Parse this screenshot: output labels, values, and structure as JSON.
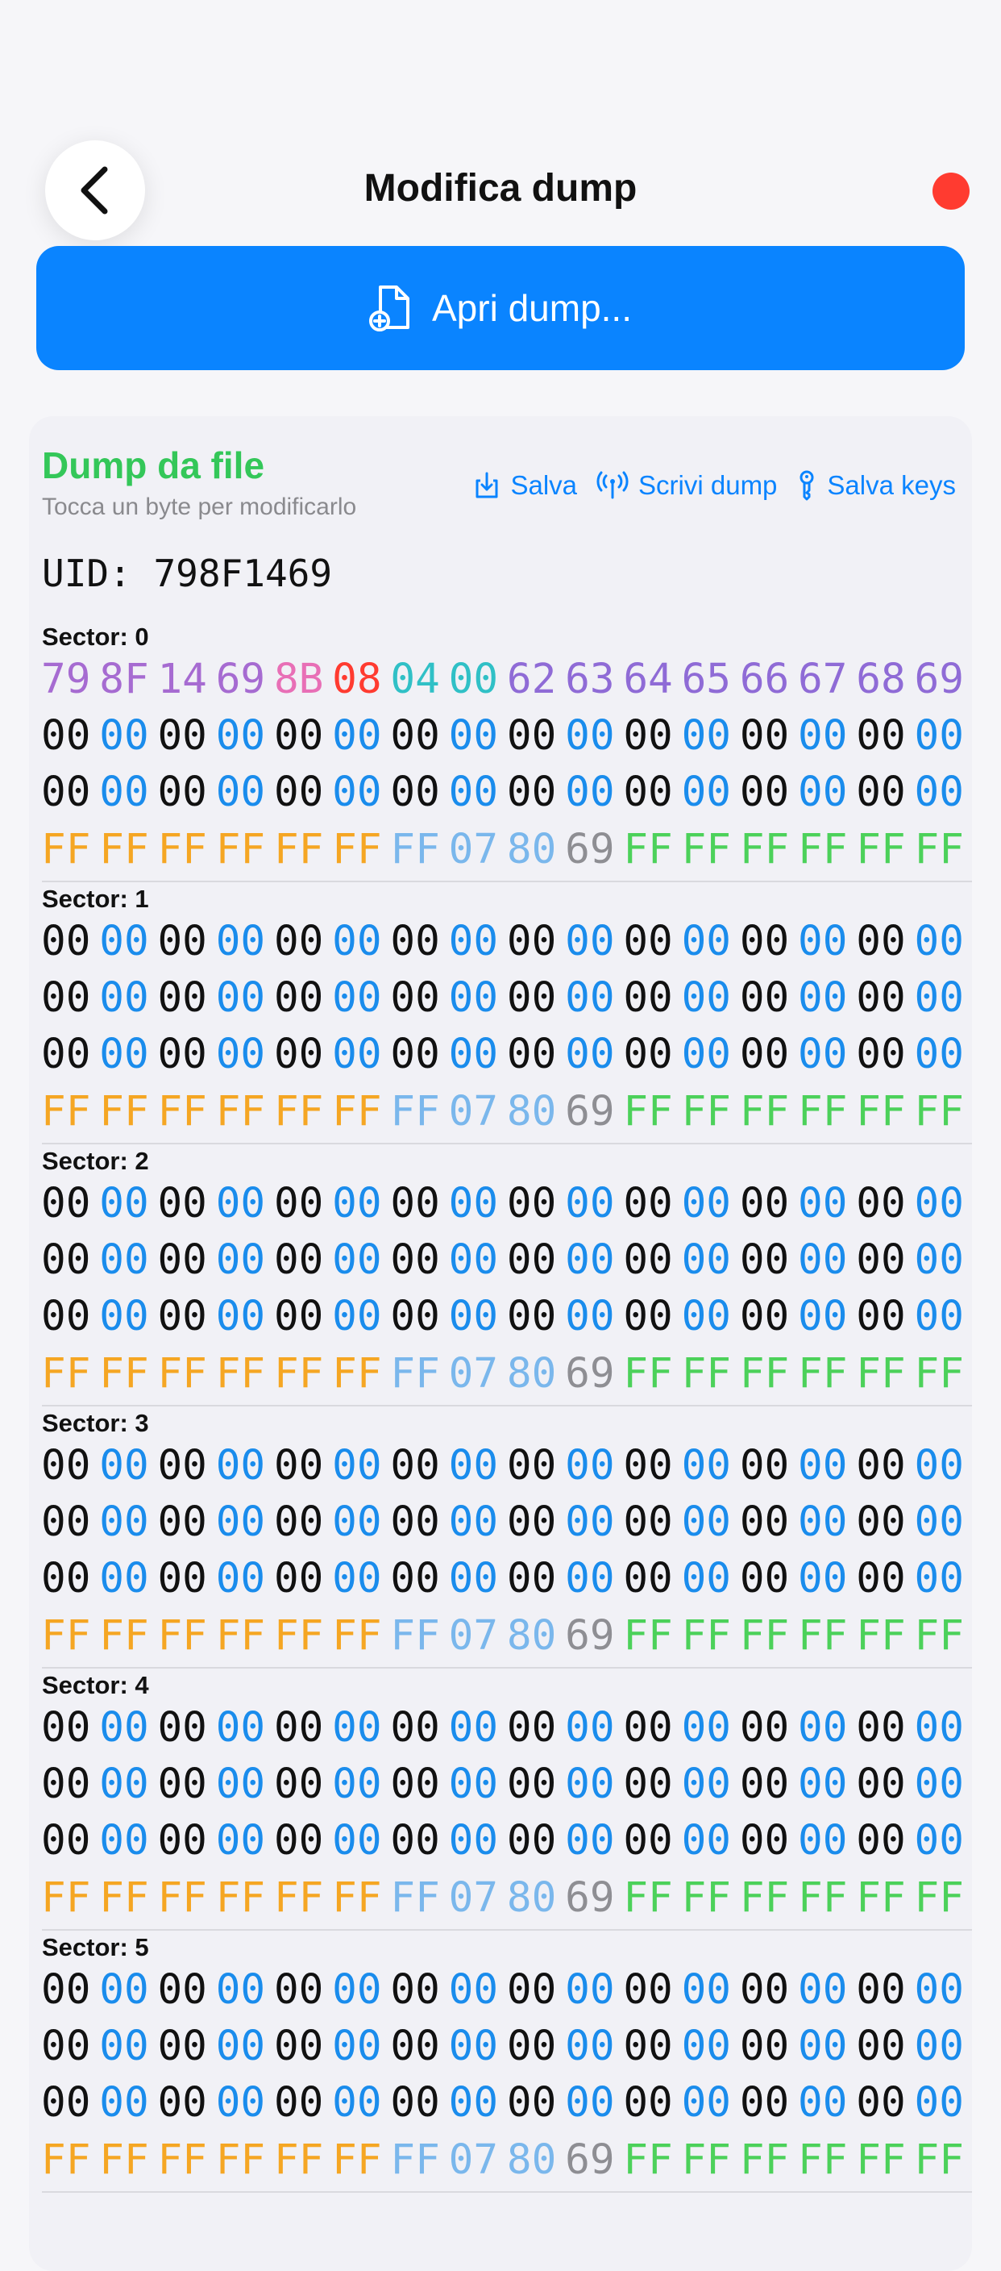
{
  "header": {
    "title": "Modifica dump"
  },
  "open_button": {
    "label": "Apri dump..."
  },
  "card": {
    "title": "Dump da file",
    "subtitle": "Tocca un byte per modificarlo",
    "actions": [
      {
        "label": "Salva",
        "icon": "download-icon"
      },
      {
        "label": "Scrivi dump",
        "icon": "antenna-icon"
      },
      {
        "label": "Salva keys",
        "icon": "key-icon"
      }
    ],
    "uid": "UID: 798F1469"
  },
  "colors": {
    "accent": "#0a84ff",
    "record_dot": "#ff3b30",
    "title_green": "#34c759",
    "byte_black": "#111111",
    "byte_blue": "#1a8cec",
    "uid_purple": "#a66bd1",
    "bcc_pink": "#e86fb6",
    "sak_red": "#ff3b30",
    "atqa_teal": "#30c0c6",
    "manufacturer_purple": "#8f6bd6",
    "key_a_orange": "#f5a623",
    "access_bits_light_blue": "#7ab7ec",
    "user_byte_gray": "#8e8e93",
    "key_b_green": "#4cd15a"
  },
  "sectors": [
    {
      "label": "Sector: 0",
      "rows": [
        [
          "79",
          "8F",
          "14",
          "69",
          "8B",
          "08",
          "04",
          "00",
          "62",
          "63",
          "64",
          "65",
          "66",
          "67",
          "68",
          "69"
        ],
        [
          "00",
          "00",
          "00",
          "00",
          "00",
          "00",
          "00",
          "00",
          "00",
          "00",
          "00",
          "00",
          "00",
          "00",
          "00",
          "00"
        ],
        [
          "00",
          "00",
          "00",
          "00",
          "00",
          "00",
          "00",
          "00",
          "00",
          "00",
          "00",
          "00",
          "00",
          "00",
          "00",
          "00"
        ],
        [
          "FF",
          "FF",
          "FF",
          "FF",
          "FF",
          "FF",
          "FF",
          "07",
          "80",
          "69",
          "FF",
          "FF",
          "FF",
          "FF",
          "FF",
          "FF"
        ]
      ]
    },
    {
      "label": "Sector: 1",
      "rows": [
        [
          "00",
          "00",
          "00",
          "00",
          "00",
          "00",
          "00",
          "00",
          "00",
          "00",
          "00",
          "00",
          "00",
          "00",
          "00",
          "00"
        ],
        [
          "00",
          "00",
          "00",
          "00",
          "00",
          "00",
          "00",
          "00",
          "00",
          "00",
          "00",
          "00",
          "00",
          "00",
          "00",
          "00"
        ],
        [
          "00",
          "00",
          "00",
          "00",
          "00",
          "00",
          "00",
          "00",
          "00",
          "00",
          "00",
          "00",
          "00",
          "00",
          "00",
          "00"
        ],
        [
          "FF",
          "FF",
          "FF",
          "FF",
          "FF",
          "FF",
          "FF",
          "07",
          "80",
          "69",
          "FF",
          "FF",
          "FF",
          "FF",
          "FF",
          "FF"
        ]
      ]
    },
    {
      "label": "Sector: 2",
      "rows": [
        [
          "00",
          "00",
          "00",
          "00",
          "00",
          "00",
          "00",
          "00",
          "00",
          "00",
          "00",
          "00",
          "00",
          "00",
          "00",
          "00"
        ],
        [
          "00",
          "00",
          "00",
          "00",
          "00",
          "00",
          "00",
          "00",
          "00",
          "00",
          "00",
          "00",
          "00",
          "00",
          "00",
          "00"
        ],
        [
          "00",
          "00",
          "00",
          "00",
          "00",
          "00",
          "00",
          "00",
          "00",
          "00",
          "00",
          "00",
          "00",
          "00",
          "00",
          "00"
        ],
        [
          "FF",
          "FF",
          "FF",
          "FF",
          "FF",
          "FF",
          "FF",
          "07",
          "80",
          "69",
          "FF",
          "FF",
          "FF",
          "FF",
          "FF",
          "FF"
        ]
      ]
    },
    {
      "label": "Sector: 3",
      "rows": [
        [
          "00",
          "00",
          "00",
          "00",
          "00",
          "00",
          "00",
          "00",
          "00",
          "00",
          "00",
          "00",
          "00",
          "00",
          "00",
          "00"
        ],
        [
          "00",
          "00",
          "00",
          "00",
          "00",
          "00",
          "00",
          "00",
          "00",
          "00",
          "00",
          "00",
          "00",
          "00",
          "00",
          "00"
        ],
        [
          "00",
          "00",
          "00",
          "00",
          "00",
          "00",
          "00",
          "00",
          "00",
          "00",
          "00",
          "00",
          "00",
          "00",
          "00",
          "00"
        ],
        [
          "FF",
          "FF",
          "FF",
          "FF",
          "FF",
          "FF",
          "FF",
          "07",
          "80",
          "69",
          "FF",
          "FF",
          "FF",
          "FF",
          "FF",
          "FF"
        ]
      ]
    },
    {
      "label": "Sector: 4",
      "rows": [
        [
          "00",
          "00",
          "00",
          "00",
          "00",
          "00",
          "00",
          "00",
          "00",
          "00",
          "00",
          "00",
          "00",
          "00",
          "00",
          "00"
        ],
        [
          "00",
          "00",
          "00",
          "00",
          "00",
          "00",
          "00",
          "00",
          "00",
          "00",
          "00",
          "00",
          "00",
          "00",
          "00",
          "00"
        ],
        [
          "00",
          "00",
          "00",
          "00",
          "00",
          "00",
          "00",
          "00",
          "00",
          "00",
          "00",
          "00",
          "00",
          "00",
          "00",
          "00"
        ],
        [
          "FF",
          "FF",
          "FF",
          "FF",
          "FF",
          "FF",
          "FF",
          "07",
          "80",
          "69",
          "FF",
          "FF",
          "FF",
          "FF",
          "FF",
          "FF"
        ]
      ]
    },
    {
      "label": "Sector: 5",
      "rows": [
        [
          "00",
          "00",
          "00",
          "00",
          "00",
          "00",
          "00",
          "00",
          "00",
          "00",
          "00",
          "00",
          "00",
          "00",
          "00",
          "00"
        ],
        [
          "00",
          "00",
          "00",
          "00",
          "00",
          "00",
          "00",
          "00",
          "00",
          "00",
          "00",
          "00",
          "00",
          "00",
          "00",
          "00"
        ],
        [
          "00",
          "00",
          "00",
          "00",
          "00",
          "00",
          "00",
          "00",
          "00",
          "00",
          "00",
          "00",
          "00",
          "00",
          "00",
          "00"
        ],
        [
          "FF",
          "FF",
          "FF",
          "FF",
          "FF",
          "FF",
          "FF",
          "07",
          "80",
          "69",
          "FF",
          "FF",
          "FF",
          "FF",
          "FF",
          "FF"
        ]
      ]
    }
  ]
}
